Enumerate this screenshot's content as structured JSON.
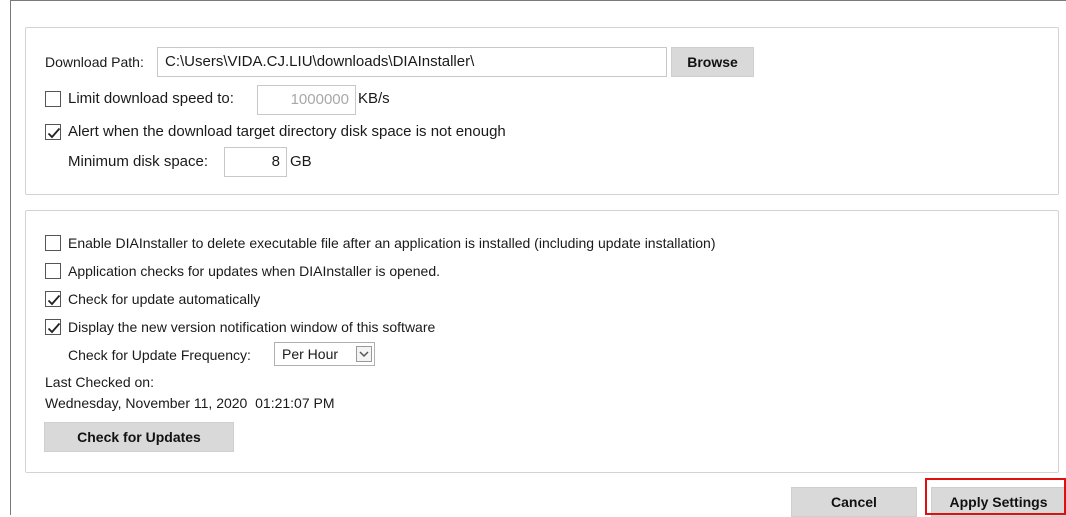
{
  "download": {
    "path_label": "Download Path:",
    "path_value": "C:\\Users\\VIDA.CJ.LIU\\downloads\\DIAInstaller\\",
    "browse_label": "Browse",
    "limit_label": "Limit download speed to:",
    "limit_checked": false,
    "limit_value": "1000000",
    "limit_unit": "KB/s",
    "alert_label": "Alert when the download target directory disk space is not enough",
    "alert_checked": true,
    "min_disk_label": "Minimum disk space:",
    "min_disk_value": "8",
    "min_disk_unit": "GB"
  },
  "updates": {
    "delete_exe_label": "Enable DIAInstaller to delete executable file after an application is installed (including update installation)",
    "delete_exe_checked": false,
    "check_on_open_label": "Application checks for updates when DIAInstaller is opened.",
    "check_on_open_checked": false,
    "auto_check_label": "Check for update automatically",
    "auto_check_checked": true,
    "notify_label": "Display the new version notification window of this software",
    "notify_checked": true,
    "frequency_label": "Check for Update Frequency:",
    "frequency_value": "Per Hour",
    "last_checked_label": "Last Checked on:",
    "last_checked_value": "Wednesday, November 11, 2020  01:21:07 PM",
    "check_button_label": "Check for Updates"
  },
  "footer": {
    "cancel_label": "Cancel",
    "apply_label": "Apply Settings"
  },
  "colors": {
    "button_bg": "#d9d9d9",
    "highlight": "#e01010",
    "panel_border": "#d3d3d3"
  }
}
